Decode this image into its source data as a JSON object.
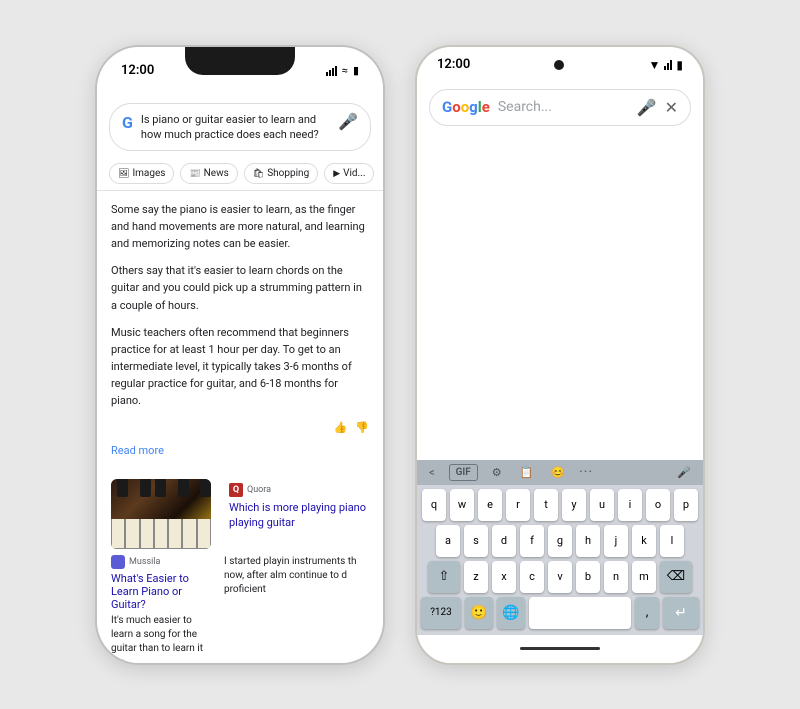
{
  "iphone": {
    "time": "12:00",
    "search_query": "Is piano or guitar easier to learn and how much practice does each need?",
    "tabs": [
      "Images",
      "News",
      "Shopping",
      "Vid..."
    ],
    "article": {
      "para1": "Some say the piano is easier to learn, as the finger and hand movements are more natural, and learning and memorizing notes can be easier.",
      "para2": "Others say that it's easier to learn chords on the guitar and you could pick up a strumming pattern in a couple of hours.",
      "para3": "Music teachers often recommend that beginners practice for at least 1 hour per day. To get to an intermediate level, it typically takes 3-6 months of regular practice for guitar, and 6-18 months for piano."
    },
    "read_more": "Read more",
    "quora_source": "Quora",
    "quora_title": "Which is more playing piano playing guitar",
    "mussila_source": "Mussila",
    "mussila_title": "What's Easier to Learn Piano or Guitar?",
    "mussila_desc": "It's much easier to learn a song for the guitar than to learn it for",
    "quora_desc": "I started playin instruments th now, after alm continue to d proficient"
  },
  "android": {
    "time": "12:00",
    "search_placeholder": "Search...",
    "keyboard": {
      "toolbar": [
        "<",
        "GIF",
        "⚙",
        "📋",
        "😊",
        "...",
        "🎤"
      ],
      "row1": [
        "q",
        "w",
        "e",
        "r",
        "t",
        "y",
        "u",
        "i",
        "o",
        "p"
      ],
      "row2": [
        "a",
        "s",
        "d",
        "f",
        "g",
        "h",
        "j",
        "k",
        "l"
      ],
      "row3": [
        "z",
        "x",
        "c",
        "v",
        "b",
        "n",
        "m"
      ],
      "bottom": [
        "?123",
        "🌐",
        " ",
        ",",
        "↵"
      ]
    }
  },
  "icons": {
    "mic": "🎤",
    "thumbup": "👍",
    "thumbdown": "👎",
    "chevron_down": "∨",
    "keyboard_icon": "⌨",
    "backspace": "⌫",
    "shift": "⇧"
  }
}
